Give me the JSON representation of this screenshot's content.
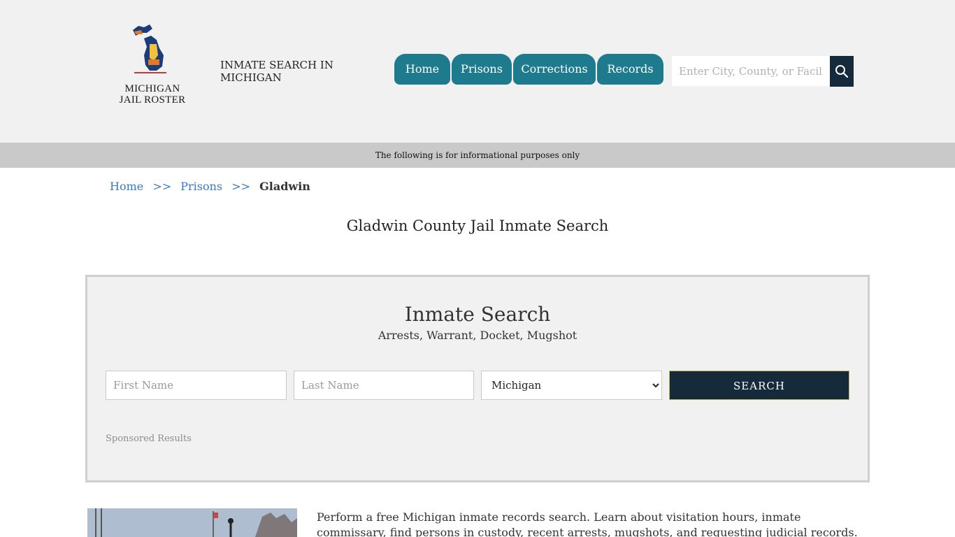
{
  "header": {
    "logo_line1": "MICHIGAN",
    "logo_line2": "JAIL ROSTER",
    "site_title": "INMATE SEARCH IN MICHIGAN"
  },
  "nav": {
    "items": [
      {
        "label": "Home"
      },
      {
        "label": "Prisons"
      },
      {
        "label": "Corrections"
      },
      {
        "label": "Records"
      }
    ]
  },
  "header_search": {
    "placeholder": "Enter City, County, or Facility"
  },
  "notice": "The following is for informational purposes only",
  "breadcrumb": {
    "home": "Home",
    "prisons": "Prisons",
    "separator": ">>",
    "current": "Gladwin"
  },
  "page_title": "Gladwin County Jail Inmate Search",
  "inmate_search": {
    "title": "Inmate Search",
    "subtitle": "Arrests, Warrant, Docket, Mugshot",
    "first_name_placeholder": "First Name",
    "last_name_placeholder": "Last Name",
    "state_selected": "Michigan",
    "submit_label": "SEARCH",
    "sponsored": "Sponsored Results"
  },
  "intro_text": "Perform a free Michigan inmate records search. Learn about visitation hours, inmate commissary, find persons in custody, recent arrests, mugshots, and requesting judicial records.",
  "colors": {
    "nav_tab": "#1e7b8e",
    "dark_navy": "#152a3b",
    "link": "#3a78c8",
    "notice_bar": "#c9c9c9",
    "header_bg": "#f1f1f1"
  }
}
